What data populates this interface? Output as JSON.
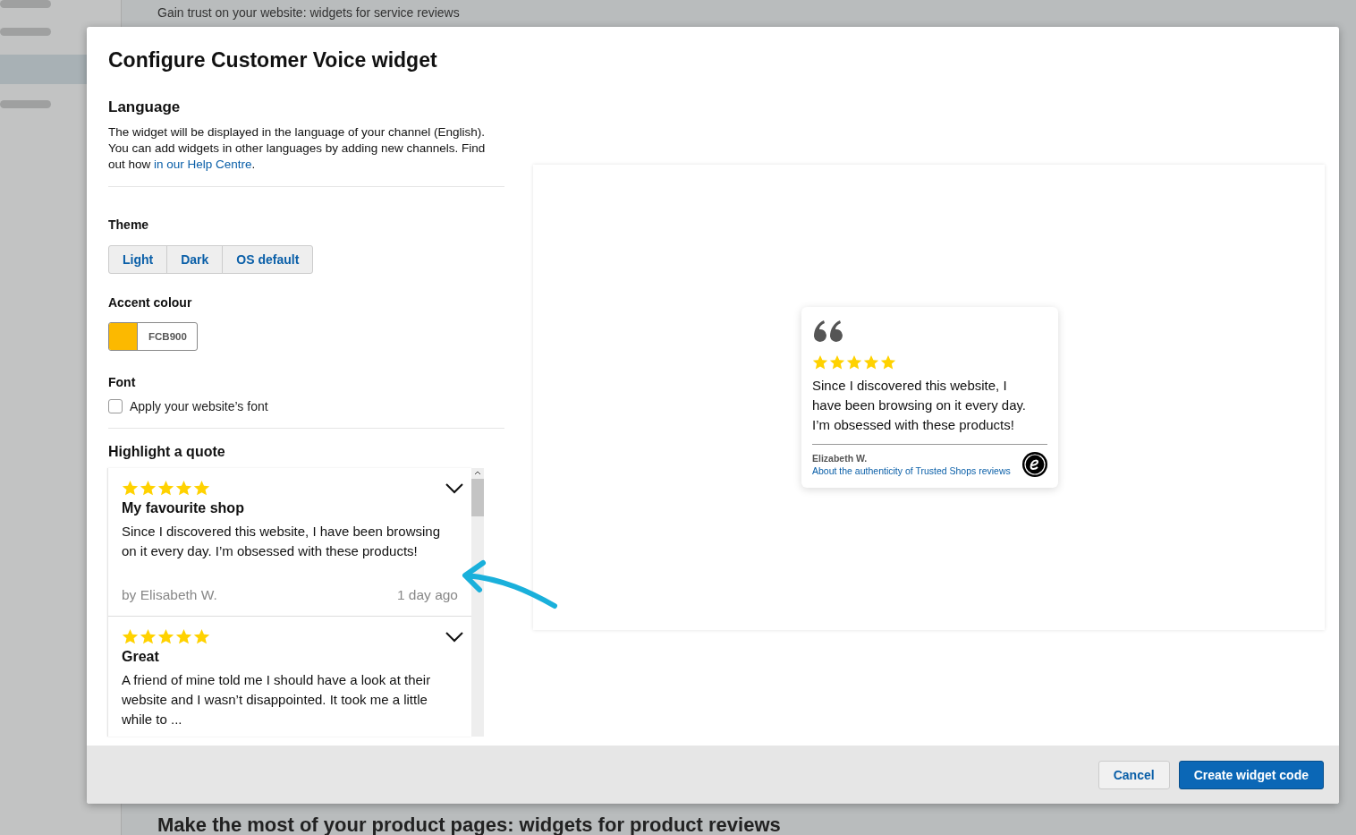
{
  "background": {
    "heading_top": "Gain trust on your website: widgets for service reviews",
    "heading_bottom": "Make the most of your product pages: widgets for product reviews"
  },
  "dialog": {
    "title": "Configure Customer Voice widget"
  },
  "language": {
    "heading": "Language",
    "text": "The widget will be displayed in the language of your channel (English). You can add widgets in other languages by adding new channels. Find out how ",
    "link": "in our Help Centre",
    "text_after": "."
  },
  "theme": {
    "heading": "Theme",
    "options": [
      {
        "label": "Light",
        "selected": false
      },
      {
        "label": "Dark",
        "selected": false
      },
      {
        "label": "OS default",
        "selected": false
      }
    ]
  },
  "accent": {
    "heading": "Accent colour",
    "value": "FCB900"
  },
  "font": {
    "heading": "Font",
    "label": "Apply your website’s font",
    "checked": false
  },
  "quotes": {
    "heading": "Highlight a quote",
    "reviews": [
      {
        "stars": 5,
        "title": "My favourite shop",
        "text": "Since I discovered this website, I have been browsing on it every day. I’m obsessed with these products!",
        "author": "by Elisabeth W.",
        "time": "1 day ago"
      },
      {
        "stars": 5,
        "title": "Great",
        "text": "A friend of mine told me I should have a look at their website and I wasn’t disappointed. It took me a little while to ..."
      }
    ]
  },
  "preview": {
    "stars": 5,
    "text": "Since I discovered this website, I have been browsing on it every day. I’m obsessed with these products!",
    "author": "Elizabeth W.",
    "link": "About the authenticity of Trusted Shops reviews"
  },
  "buttons": [
    {
      "label": "Cancel",
      "kind": "secondary"
    },
    {
      "label": "Create widget code",
      "kind": "primary"
    }
  ]
}
